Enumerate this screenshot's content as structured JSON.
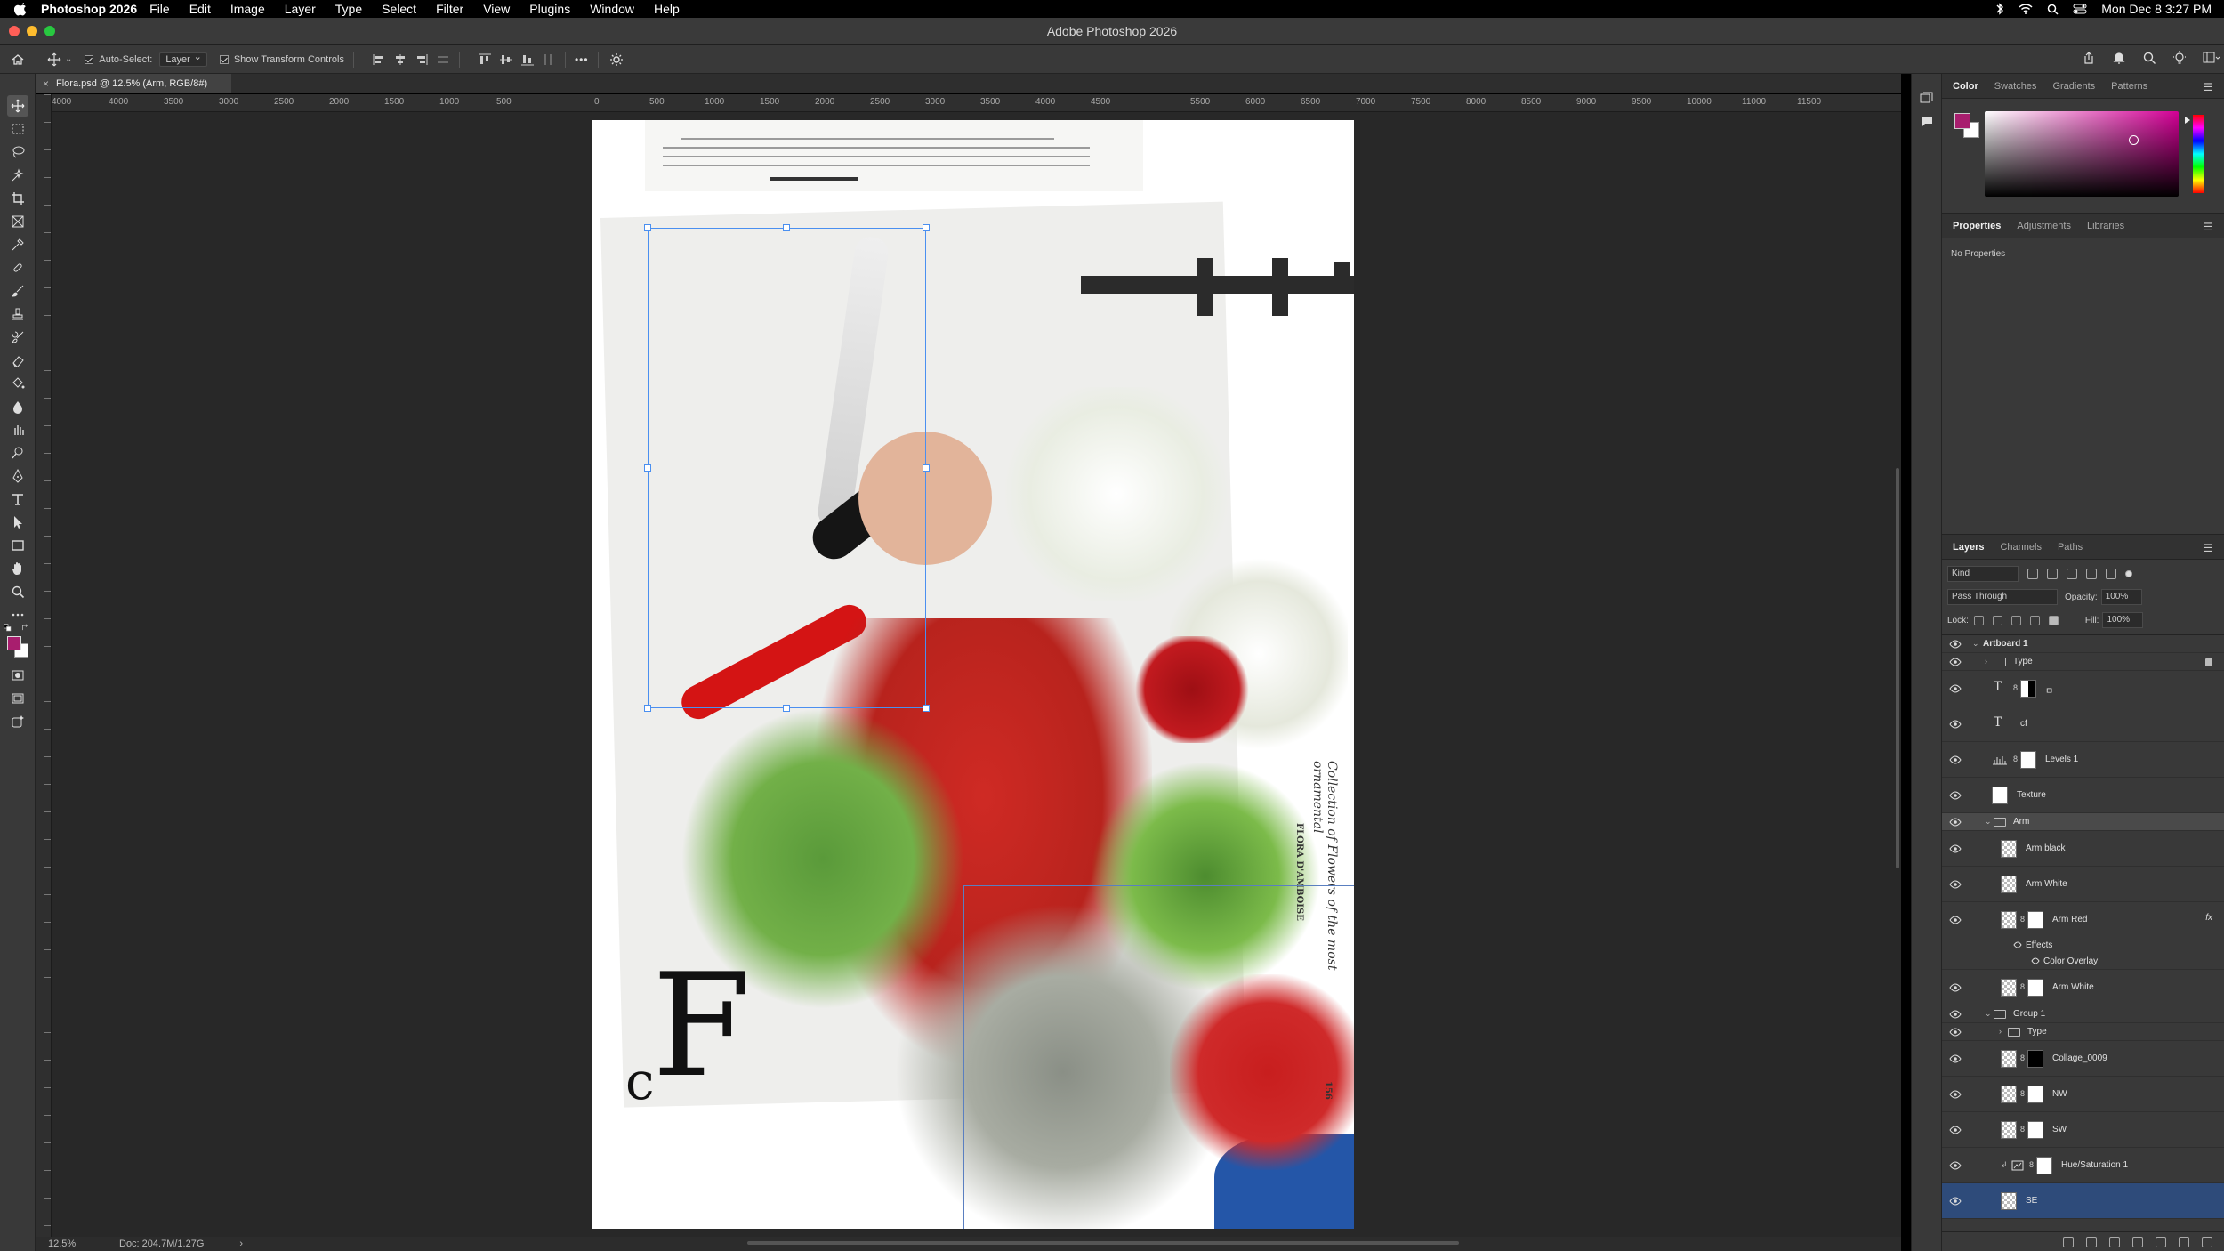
{
  "menubar": {
    "app_name": "Photoshop 2026",
    "items": [
      "File",
      "Edit",
      "Image",
      "Layer",
      "Type",
      "Select",
      "Filter",
      "View",
      "Plugins",
      "Window",
      "Help"
    ],
    "clock": "Mon Dec 8  3:27 PM"
  },
  "window": {
    "title": "Adobe Photoshop 2026"
  },
  "options": {
    "auto_select_label": "Auto-Select:",
    "auto_select_value": "Layer",
    "transform_label": "Show Transform Controls",
    "more": "•••"
  },
  "document": {
    "tab_label": "Flora.psd @ 12.5% (Arm, RGB/8#)"
  },
  "ruler": {
    "labels": [
      "4000",
      "4000",
      "3500",
      "3000",
      "2500",
      "2000",
      "1500",
      "1000",
      "500",
      "0",
      "500",
      "1000",
      "1500",
      "2000",
      "2500",
      "3000",
      "3500",
      "4000",
      "4500",
      "5500",
      "6000",
      "6500",
      "7000",
      "7500",
      "8000",
      "8500",
      "9000",
      "9500",
      "10000",
      "11000",
      "11500"
    ]
  },
  "canvas_text": {
    "logo_F": "F",
    "logo_c": "c",
    "side_text": "Collection of Flowers of the most ornamental",
    "side_text2": "FLORA D'AMBOISE",
    "page_number": "156"
  },
  "status": {
    "zoom": "12.5%",
    "doc_size": "Doc: 204.7M/1.27G",
    "arrow": "›"
  },
  "color_panel": {
    "tabs": [
      "Color",
      "Swatches",
      "Gradients",
      "Patterns"
    ],
    "active_tab": "Color",
    "foreground": "#a81e6e",
    "background": "#ffffff"
  },
  "properties_panel": {
    "tabs": [
      "Properties",
      "Adjustments",
      "Libraries"
    ],
    "active_tab": "Properties",
    "empty_text": "No Properties"
  },
  "layers_panel": {
    "tabs": [
      "Layers",
      "Channels",
      "Paths"
    ],
    "active_tab": "Layers",
    "filter_kind": "Kind",
    "blend_mode": "Pass Through",
    "opacity_label": "Opacity:",
    "opacity": "100%",
    "lock_label": "Lock:",
    "fill_label": "Fill:",
    "fill": "100%",
    "layers": [
      {
        "name": "Artboard 1",
        "kind": "artboard"
      },
      {
        "name": "Type",
        "kind": "group",
        "locked": true
      },
      {
        "name": "ㅁ",
        "kind": "text-masked"
      },
      {
        "name": "cf",
        "kind": "text"
      },
      {
        "name": "Levels 1",
        "kind": "adjustment"
      },
      {
        "name": "Texture",
        "kind": "smart"
      },
      {
        "name": "Arm",
        "kind": "group-open"
      },
      {
        "name": "Arm black",
        "kind": "pixel"
      },
      {
        "name": "Arm White",
        "kind": "pixel"
      },
      {
        "name": "Arm Red",
        "kind": "pixel-mask",
        "fx": "fx"
      },
      {
        "name": "Effects",
        "kind": "effects"
      },
      {
        "name": "Color Overlay",
        "kind": "effect-item"
      },
      {
        "name": "Arm White",
        "kind": "pixel-mask"
      },
      {
        "name": "Group 1",
        "kind": "group-open"
      },
      {
        "name": "Type",
        "kind": "group"
      },
      {
        "name": "Collage_0009",
        "kind": "smart-mask"
      },
      {
        "name": "NW",
        "kind": "smart-mask"
      },
      {
        "name": "SW",
        "kind": "smart-mask"
      },
      {
        "name": "Hue/Saturation 1",
        "kind": "adjustment-clip"
      },
      {
        "name": "SE",
        "kind": "smart-selected"
      }
    ]
  }
}
